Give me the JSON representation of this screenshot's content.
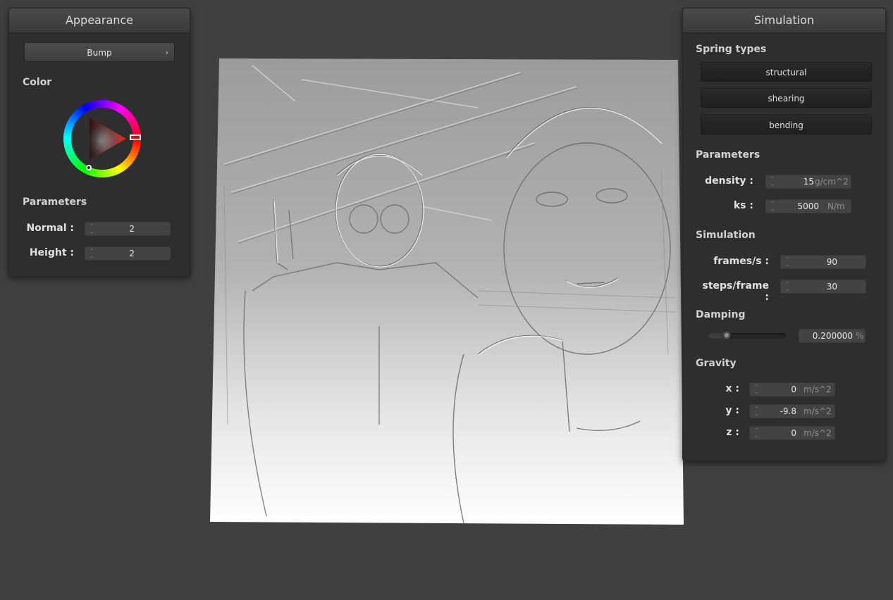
{
  "appearance": {
    "title": "Appearance",
    "shader_selected": "Bump",
    "color_label": "Color",
    "parameters_label": "Parameters",
    "params": [
      {
        "label": "Normal :",
        "value": "2"
      },
      {
        "label": "Height :",
        "value": "2"
      }
    ]
  },
  "simulation": {
    "title": "Simulation",
    "spring_types_label": "Spring types",
    "spring_types": [
      "structural",
      "shearing",
      "bending"
    ],
    "parameters_label": "Parameters",
    "density": {
      "label": "density :",
      "value": "15",
      "unit": "g/cm^2"
    },
    "ks": {
      "label": "ks :",
      "value": "5000",
      "unit": "N/m"
    },
    "simulation_label": "Simulation",
    "frames": {
      "label": "frames/s :",
      "value": "90"
    },
    "steps": {
      "label": "steps/frame :",
      "value": "30"
    },
    "damping_label": "Damping",
    "damping": {
      "value": "0.200000",
      "unit": "%",
      "slider_fraction": 0.2
    },
    "gravity_label": "Gravity",
    "gravity": [
      {
        "label": "x :",
        "value": "0",
        "unit": "m/s^2"
      },
      {
        "label": "y :",
        "value": "-9.8",
        "unit": "m/s^2"
      },
      {
        "label": "z :",
        "value": "0",
        "unit": "m/s^2"
      }
    ]
  },
  "colors": {
    "background": "#404040",
    "panel": "#2e2e2e",
    "selected_color": "#ff0000"
  },
  "icons": {
    "dropdown": "chevron-right-icon",
    "spinner": "spinner-arrows-icon"
  }
}
